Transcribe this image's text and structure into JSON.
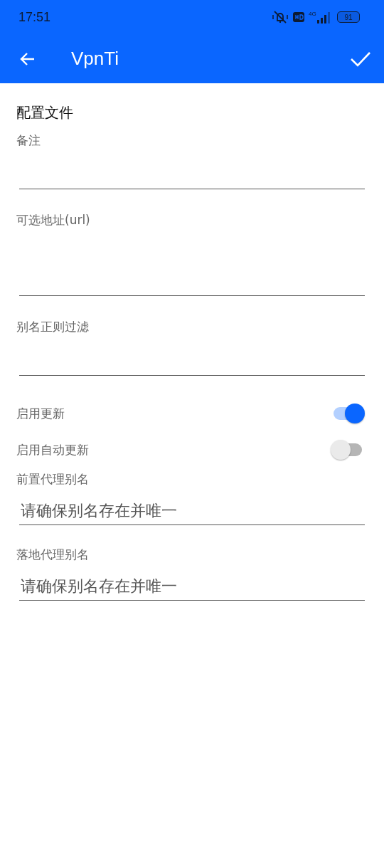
{
  "status_bar": {
    "time": "17:51",
    "network": "4G",
    "battery": "91"
  },
  "app_bar": {
    "title": "VpnTi"
  },
  "section_title": "配置文件",
  "items": [
    {
      "kind": "text",
      "label": "备注"
    },
    {
      "kind": "multiline",
      "label": "可选地址(url)"
    },
    {
      "kind": "text",
      "label": "别名正则过滤"
    },
    {
      "kind": "switch",
      "label": "启用更新",
      "on": true
    },
    {
      "kind": "switch",
      "label": "启用自动更新",
      "on": false
    },
    {
      "kind": "text",
      "label": "前置代理别名",
      "placeholder": "请确保别名存在并唯一"
    },
    {
      "kind": "text",
      "label": "落地代理别名",
      "placeholder": "请确保别名存在并唯一"
    }
  ]
}
